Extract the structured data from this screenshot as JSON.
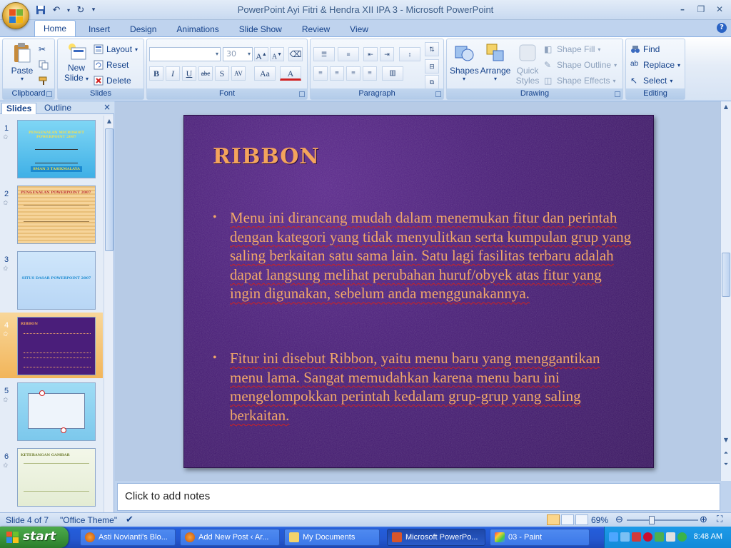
{
  "window": {
    "title": "PowerPoint Ayi Fitri & Hendra XII IPA 3 - Microsoft PowerPoint",
    "controls": [
      "–",
      "❐",
      "✕"
    ]
  },
  "ribbon_tabs": [
    "Home",
    "Insert",
    "Design",
    "Animations",
    "Slide Show",
    "Review",
    "View"
  ],
  "ribbon": {
    "clipboard": {
      "label": "Clipboard",
      "paste": "Paste"
    },
    "slides": {
      "label": "Slides",
      "new_slide_line1": "New",
      "new_slide_line2": "Slide",
      "layout": "Layout",
      "reset": "Reset",
      "delete": "Delete"
    },
    "font": {
      "label": "Font",
      "font_name": "",
      "font_size": "30"
    },
    "paragraph": {
      "label": "Paragraph"
    },
    "drawing": {
      "label": "Drawing",
      "shapes": "Shapes",
      "arrange": "Arrange",
      "quick_styles_line1": "Quick",
      "quick_styles_line2": "Styles",
      "shape_fill": "Shape Fill",
      "shape_outline": "Shape Outline",
      "shape_effects": "Shape Effects"
    },
    "editing": {
      "label": "Editing",
      "find": "Find",
      "replace": "Replace",
      "select": "Select"
    }
  },
  "panel": {
    "tab_slides": "Slides",
    "tab_outline": "Outline",
    "close": "×"
  },
  "thumbnails": [
    {
      "num": "1",
      "title": "PENGENALAN MICROSOFT POWERPOINT 2007",
      "subtitle": "SMAN 3 TASIKMALAYA"
    },
    {
      "num": "2",
      "title": "PENGENALAN POWERPOINT 2007"
    },
    {
      "num": "3",
      "title": "SITUS DASAR POWERPOINT 2007"
    },
    {
      "num": "4",
      "title": "RIBBON"
    },
    {
      "num": "5"
    },
    {
      "num": "6",
      "title": "KETERANGAN GAMBAR"
    }
  ],
  "slide": {
    "title": "RIBBON",
    "bullets": [
      "Menu ini dirancang mudah dalam menemukan fitur dan perintah dengan kategori yang tidak menyulitkan serta kumpulan grup yang saling berkaitan satu sama lain. Satu lagi fasilitas terbaru adalah dapat langsung melihat perubahan huruf/obyek atas fitur yang ingin digunakan, sebelum anda menggunakannya.",
      "Fitur ini disebut Ribbon, yaitu menu baru yang menggantikan menu lama. Sangat memudahkan karena menu baru ini mengelompokkan perintah kedalam grup-grup yang saling berkaitan."
    ]
  },
  "notes_placeholder": "Click to add notes",
  "status": {
    "slide_of": "Slide 4 of 7",
    "theme": "\"Office Theme\"",
    "zoom": "69%",
    "zoom_fraction": 0.69
  },
  "taskbar": {
    "start": "start",
    "tasks": [
      "Asti Novianti's Blo...",
      "Add New Post ‹ Ar...",
      "My Documents",
      "Microsoft PowerPo...",
      "03 - Paint"
    ],
    "clock": "8:48 AM"
  },
  "colors": {
    "slide_bg": "#4a1e7a",
    "slide_text": "#f2a868",
    "ribbon_text": "#15428b",
    "selected_thumb": "#f2b55a"
  }
}
